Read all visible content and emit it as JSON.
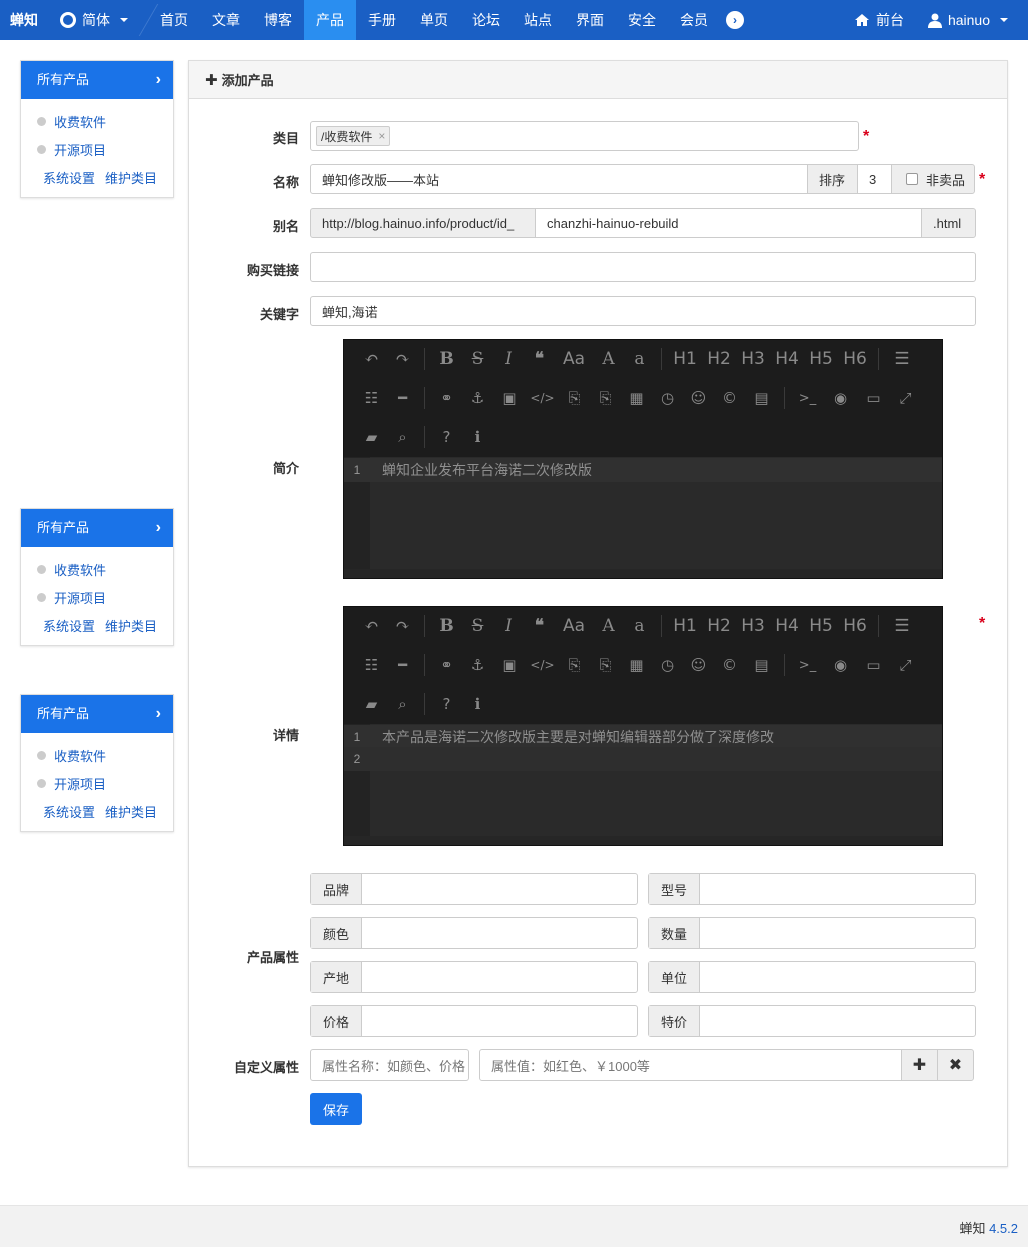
{
  "navbar": {
    "brand": "蝉知",
    "lang": "简体",
    "items": [
      "首页",
      "文章",
      "博客",
      "产品",
      "手册",
      "单页",
      "论坛",
      "站点",
      "界面",
      "安全",
      "会员"
    ],
    "active_index": 3,
    "frontend": "前台",
    "user": "hainuo"
  },
  "sidebar": {
    "title": "所有产品",
    "items": [
      "收费软件",
      "开源项目"
    ],
    "links": [
      "系统设置",
      "维护类目"
    ]
  },
  "panel": {
    "title": "添加产品"
  },
  "form": {
    "category_label": "类目",
    "category_tag": "/收费软件",
    "name_label": "名称",
    "name_value": "蝉知修改版——本站",
    "order_label": "排序",
    "order_value": "3",
    "not_for_sale_label": "非卖品",
    "alias_label": "别名",
    "alias_prefix": "http://blog.hainuo.info/product/id_",
    "alias_value": "chanzhi-hainuo-rebuild",
    "alias_suffix": ".html",
    "buy_link_label": "购买链接",
    "buy_link_value": "",
    "keywords_label": "关键字",
    "keywords_value": "蝉知,海诺",
    "summary_label": "简介",
    "summary_lines": [
      "蝉知企业发布平台海诺二次修改版"
    ],
    "detail_label": "详情",
    "detail_lines": [
      "本产品是海诺二次修改版主要是对蝉知编辑器部分做了深度修改",
      ""
    ],
    "attributes_label": "产品属性",
    "attributes": [
      {
        "name": "品牌",
        "value": ""
      },
      {
        "name": "型号",
        "value": ""
      },
      {
        "name": "颜色",
        "value": ""
      },
      {
        "name": "数量",
        "value": ""
      },
      {
        "name": "产地",
        "value": ""
      },
      {
        "name": "单位",
        "value": ""
      },
      {
        "name": "价格",
        "value": ""
      },
      {
        "name": "特价",
        "value": ""
      }
    ],
    "custom_attr_label": "自定义属性",
    "custom_name_placeholder": "属性名称：如颜色、价格",
    "custom_value_placeholder": "属性值：如红色、￥1000等",
    "save_label": "保存"
  },
  "editor_toolbar": {
    "heading_buttons": [
      "H1",
      "H2",
      "H3",
      "H4",
      "H5",
      "H6"
    ]
  },
  "footer": {
    "product": "蝉知",
    "version": "4.5.2"
  },
  "colors": {
    "navbar": "#1a5fc4",
    "active_nav": "#2a8ef0",
    "required": "#d9001b",
    "editor_bg": "#262626"
  }
}
